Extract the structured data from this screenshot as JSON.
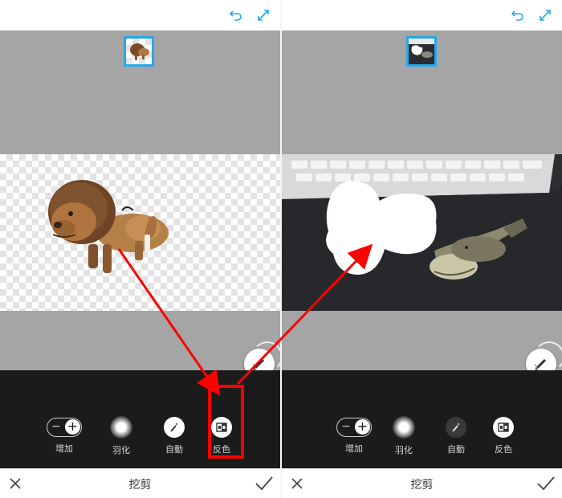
{
  "panels": {
    "left": {
      "tools": [
        {
          "label": "增加",
          "icon": "add-stepper-icon"
        },
        {
          "label": "羽化",
          "icon": "feather-icon"
        },
        {
          "label": "自動",
          "icon": "magic-wand-icon"
        },
        {
          "label": "反色",
          "icon": "invert-icon"
        }
      ],
      "bottom_title": "挖剪"
    },
    "right": {
      "tools": [
        {
          "label": "增加",
          "icon": "add-stepper-icon"
        },
        {
          "label": "羽化",
          "icon": "feather-icon"
        },
        {
          "label": "自動",
          "icon": "magic-wand-icon"
        },
        {
          "label": "反色",
          "icon": "invert-icon"
        }
      ],
      "bottom_title": "挖剪"
    }
  },
  "colors": {
    "accent": "#2aa6e6",
    "annotation": "#ff0000",
    "toolbar_bg": "#1b1b1b",
    "canvas_gray": "#a5a5a5"
  }
}
